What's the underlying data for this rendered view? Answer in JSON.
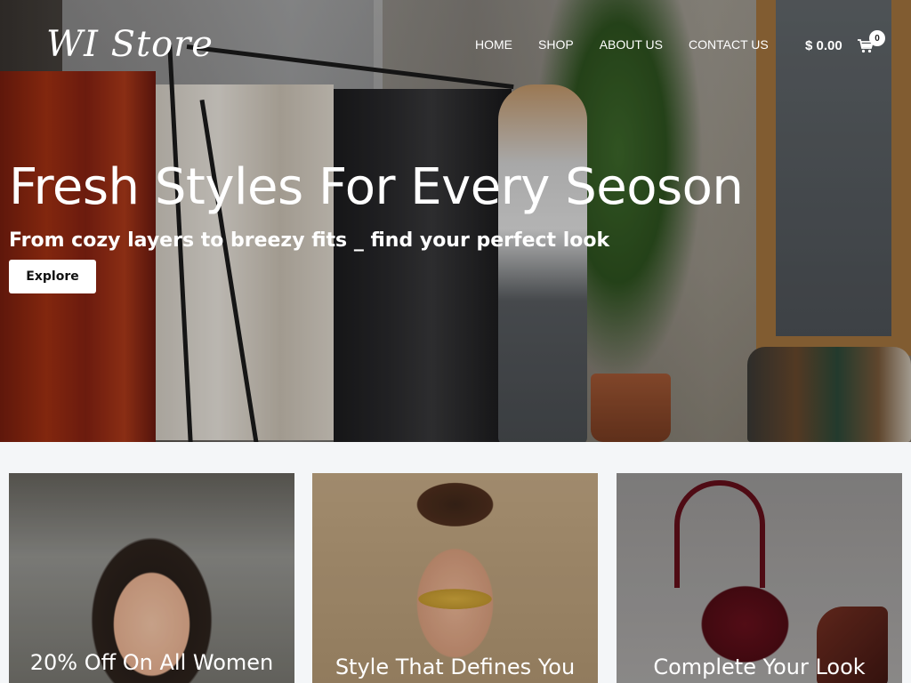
{
  "header": {
    "logo": "WI Store",
    "nav": [
      "HOME",
      "SHOP",
      "ABOUT US",
      "CONTACT US"
    ],
    "cart_total": "$ 0.00",
    "cart_count": "0"
  },
  "hero": {
    "title": "Fresh Styles For Every Seoson",
    "subtitle": "From cozy layers to breezy fits _ find your perfect look",
    "button": "Explore"
  },
  "cards": [
    {
      "label": "20% Off On All Women"
    },
    {
      "label": "Style That Defines You"
    },
    {
      "label": "Complete Your Look"
    }
  ],
  "colors": {
    "text": "#ffffff",
    "page_bg": "#f4f6f8",
    "button_bg": "#ffffff"
  },
  "icons": {
    "cart": "shopping-cart-icon"
  }
}
